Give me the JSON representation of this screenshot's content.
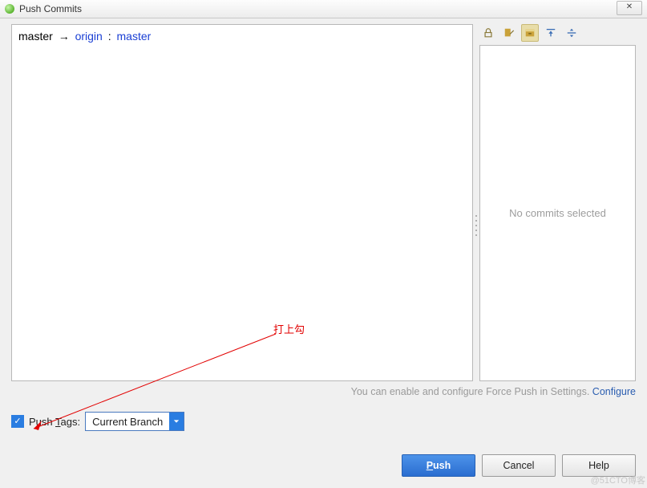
{
  "window": {
    "title": "Push Commits",
    "close_glyph": "✕"
  },
  "branch": {
    "local": "master",
    "arrow": "→",
    "remote_name": "origin",
    "colon": ":",
    "remote_branch": "master"
  },
  "preview": {
    "empty_text": "No commits selected"
  },
  "hint": {
    "text": "You can enable and configure Force Push in Settings. ",
    "link": "Configure"
  },
  "tags": {
    "checked": true,
    "label_pre": "Push ",
    "label_ul": "T",
    "label_post": "ags:",
    "combo_value": "Current Branch"
  },
  "buttons": {
    "push_ul": "P",
    "push_rest": "ush",
    "cancel": "Cancel",
    "help": "Help"
  },
  "annotation": {
    "label": "打上勾"
  },
  "watermark": "@51CTO博客",
  "toolbar_icons": [
    "lock-icon",
    "edit-icon",
    "collapse-icon",
    "expand-top-icon",
    "expand-mid-icon"
  ]
}
